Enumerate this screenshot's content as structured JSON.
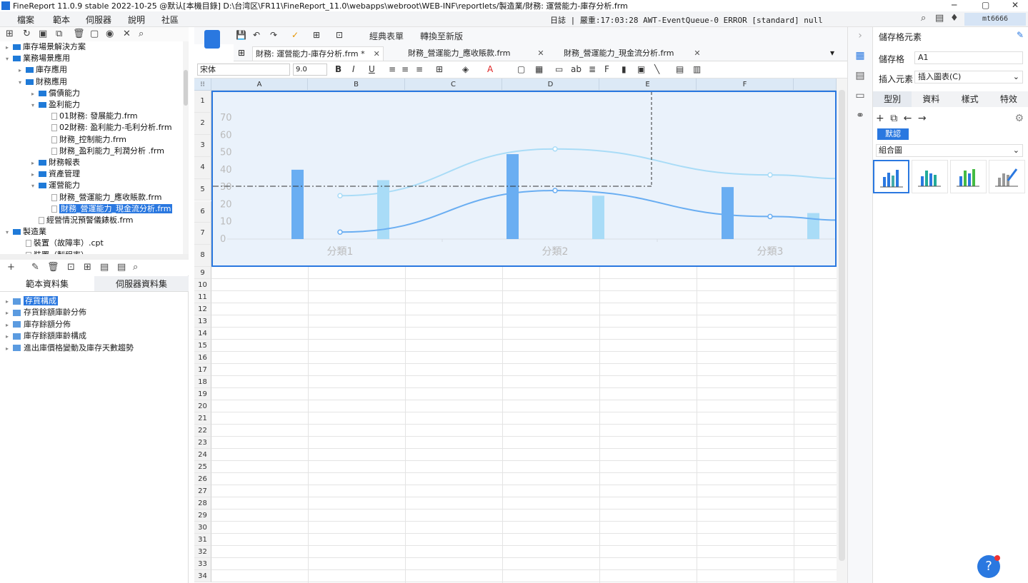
{
  "window": {
    "title": "FineReport 11.0.9 stable 2022-10-25 @默认[本機目錄]   D:\\台湾区\\FR11\\FineReport_11.0\\webapps\\webroot\\WEB-INF\\reportlets/製造業/財務: 運營能力-庫存分析.frm",
    "min": "─",
    "max": "▢",
    "close": "✕"
  },
  "menu": {
    "items": [
      "檔案",
      "範本",
      "伺服器",
      "說明",
      "社區"
    ],
    "log": "日誌 | 嚴重:17:03:28 AWT-EventQueue-0 ERROR [standard] null",
    "user": "mt6666"
  },
  "tree": {
    "items": [
      {
        "label": "庫存場景解決方案",
        "type": "folder",
        "level": 0,
        "arrow": "▸"
      },
      {
        "label": "業務場景應用",
        "type": "folder",
        "level": 0,
        "arrow": "▾"
      },
      {
        "label": "庫存應用",
        "type": "folder",
        "level": 1,
        "arrow": "▸"
      },
      {
        "label": "財務應用",
        "type": "folder",
        "level": 1,
        "arrow": "▾"
      },
      {
        "label": "償債能力",
        "type": "folder",
        "level": 2,
        "arrow": "▸"
      },
      {
        "label": "盈利能力",
        "type": "folder",
        "level": 2,
        "arrow": "▾"
      },
      {
        "label": "01財務: 發展能力.frm",
        "type": "file",
        "level": 3
      },
      {
        "label": "02財務: 盈利能力-毛利分析.frm",
        "type": "file",
        "level": 3
      },
      {
        "label": "財務_控制能力.frm",
        "type": "file",
        "level": 3
      },
      {
        "label": "財務_盈利能力_利潤分析 .frm",
        "type": "file",
        "level": 3
      },
      {
        "label": "財務報表",
        "type": "folder",
        "level": 2,
        "arrow": "▸"
      },
      {
        "label": "資產管理",
        "type": "folder",
        "level": 2,
        "arrow": "▸"
      },
      {
        "label": "運營能力",
        "type": "folder",
        "level": 2,
        "arrow": "▾"
      },
      {
        "label": "財務_營運能力_應收賬款.frm",
        "type": "file",
        "level": 3
      },
      {
        "label": "財務_營運能力_現金流分析.frm",
        "type": "file",
        "level": 3,
        "selected": true
      },
      {
        "label": "經營情況預警儀錶板.frm",
        "type": "file",
        "level": 2
      },
      {
        "label": "製造業",
        "type": "folder",
        "level": 0,
        "arrow": "▾"
      },
      {
        "label": "裝置（故障率）.cpt",
        "type": "file",
        "level": 1
      },
      {
        "label": "裝置（製程率）",
        "type": "file",
        "level": 1
      }
    ]
  },
  "datasets": {
    "tab_template": "範本資料集",
    "tab_server": "伺服器資料集",
    "items": [
      {
        "label": "存貨構成",
        "selected": true
      },
      {
        "label": "存貨餘額庫齡分佈"
      },
      {
        "label": "庫存餘額分佈"
      },
      {
        "label": "庫存餘額庫齡構成"
      },
      {
        "label": "進出庫價格變動及庫存天數趨勢"
      }
    ]
  },
  "toolbar": {
    "classic_form": "經典表單",
    "switch_new": "轉換至新版",
    "font": "宋体",
    "font_size": "9.0"
  },
  "tabs": [
    {
      "label": "財務: 運營能力-庫存分析.frm *",
      "active": true
    },
    {
      "label": "財務_營運能力_應收賬款.frm"
    },
    {
      "label": "財務_營運能力_現金流分析.frm"
    }
  ],
  "grid": {
    "columns": [
      "A",
      "B",
      "C",
      "D",
      "E",
      "F"
    ],
    "rows": [
      "1",
      "2",
      "3",
      "4",
      "5",
      "6",
      "7",
      "8",
      "9",
      "10",
      "11",
      "12",
      "13",
      "14",
      "15",
      "16",
      "17",
      "18",
      "19",
      "20",
      "21",
      "22",
      "23",
      "24",
      "25",
      "26",
      "27",
      "28",
      "29",
      "30",
      "31",
      "32",
      "33",
      "34"
    ]
  },
  "chart_data": {
    "type": "bar",
    "categories": [
      "分類1",
      "分類2",
      "分類3"
    ],
    "yticks": [
      "0",
      "10",
      "20",
      "30",
      "40",
      "50",
      "60",
      "70"
    ],
    "ylim": [
      0,
      70
    ],
    "series": [
      {
        "kind": "bar",
        "values": [
          40,
          49,
          30
        ],
        "color": "#6aaef2"
      },
      {
        "kind": "bar",
        "values": [
          34,
          25,
          15
        ],
        "color": "#a9dcf7"
      },
      {
        "kind": "line",
        "values": [
          4,
          28,
          13
        ],
        "color": "#6aaef2"
      },
      {
        "kind": "line",
        "values": [
          25,
          52,
          37
        ],
        "color": "#a9dcf7"
      }
    ]
  },
  "right": {
    "title": "儲存格元素",
    "cell_label": "儲存格",
    "cell_value": "A1",
    "insert_label": "插入元素",
    "insert_value": "插入圖表(C)",
    "tabs": [
      "型別",
      "資料",
      "樣式",
      "特效"
    ],
    "default_btn": "默認",
    "chart_type": "組合圖"
  },
  "help": "?"
}
